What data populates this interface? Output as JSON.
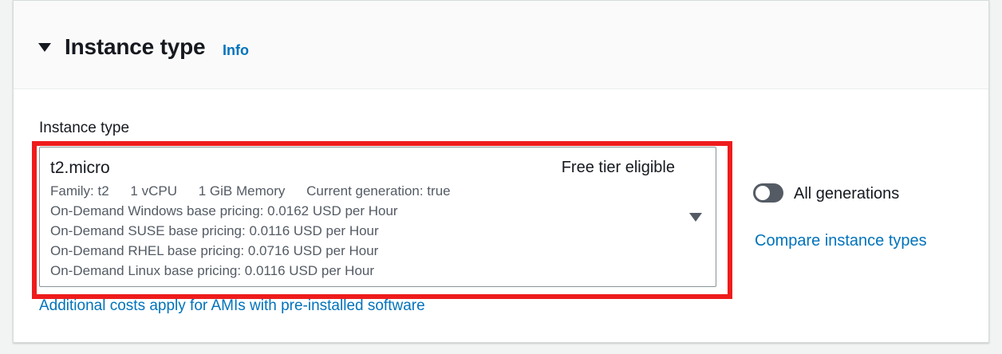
{
  "section": {
    "title": "Instance type",
    "info_link": "Info",
    "field_label": "Instance type"
  },
  "selected_instance": {
    "name": "t2.micro",
    "tag": "Free tier eligible",
    "family": "Family: t2",
    "vcpu": "1 vCPU",
    "memory": "1 GiB Memory",
    "current_generation": "Current generation: true",
    "pricing": [
      "On-Demand Windows base pricing: 0.0162 USD per Hour",
      "On-Demand SUSE base pricing: 0.0116 USD per Hour",
      "On-Demand RHEL base pricing: 0.0716 USD per Hour",
      "On-Demand Linux base pricing: 0.0116 USD per Hour"
    ]
  },
  "help_link": "Additional costs apply for AMIs with pre-installed software",
  "all_generations_toggle": {
    "label": "All generations",
    "enabled": false
  },
  "compare_link": "Compare instance types",
  "colors": {
    "link": "#0073bb",
    "highlight": "#ee1c1c",
    "toggle_off": "#545b64"
  },
  "icons": {
    "section_toggle": "caret-down-icon",
    "select_dropdown": "caret-down-icon"
  }
}
